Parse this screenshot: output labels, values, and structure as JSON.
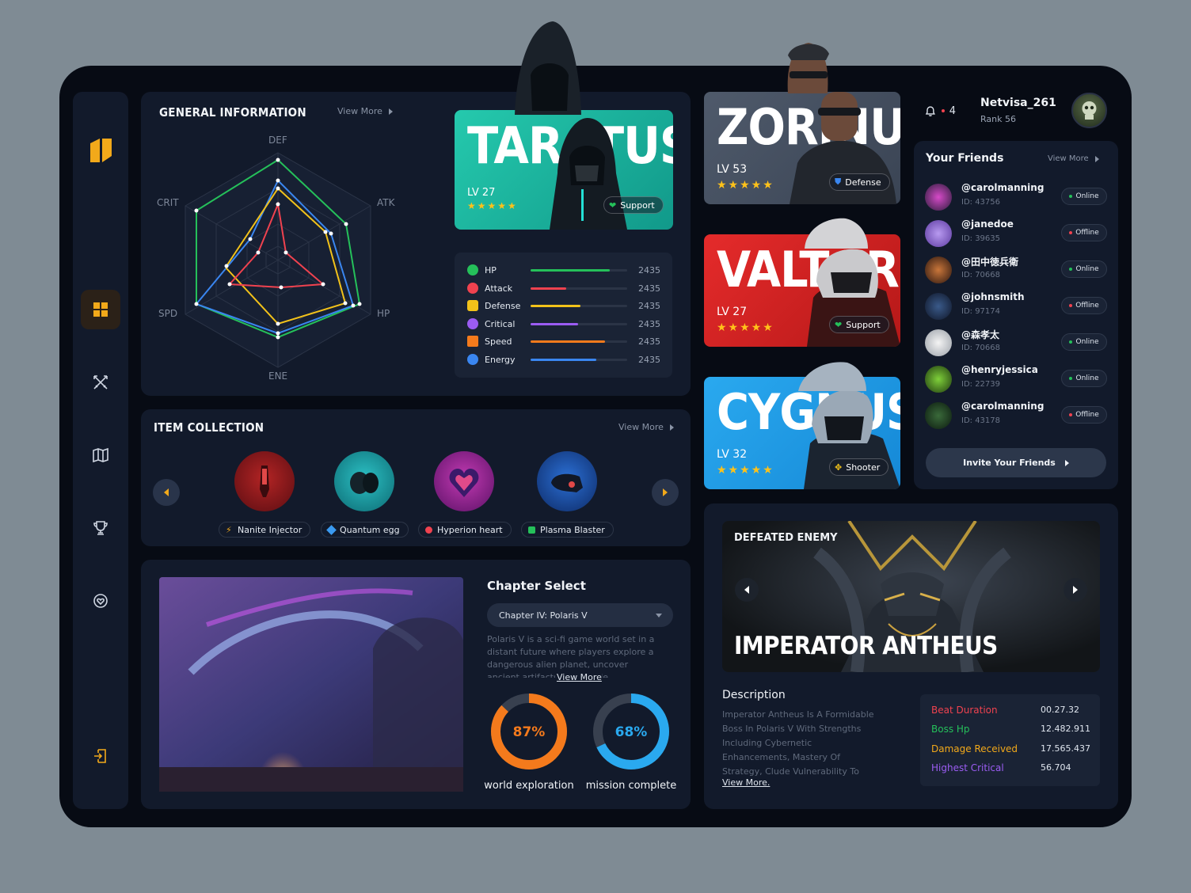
{
  "general": {
    "title": "GENERAL INFORMATION",
    "view_more": "View More",
    "radar_labels": [
      "DEF",
      "ATK",
      "HP",
      "ENE",
      "SPD",
      "CRIT"
    ]
  },
  "stats": [
    {
      "label": "HP",
      "value": "2435",
      "fill": 0.82,
      "color": "#25c05a"
    },
    {
      "label": "Attack",
      "value": "2435",
      "fill": 0.37,
      "color": "#f0424f"
    },
    {
      "label": "Defense",
      "value": "2435",
      "fill": 0.52,
      "color": "#f2c21a"
    },
    {
      "label": "Critical",
      "value": "2435",
      "fill": 0.49,
      "color": "#9b5cf2"
    },
    {
      "label": "Speed",
      "value": "2435",
      "fill": 0.77,
      "color": "#f47a1c"
    },
    {
      "label": "Energy",
      "value": "2435",
      "fill": 0.68,
      "color": "#3a86f0"
    }
  ],
  "heroes": [
    {
      "name": "TARATUS",
      "level": "LV 27",
      "role": "Support",
      "stars": "★★★★★"
    },
    {
      "name": "ZORINUS",
      "level": "LV 53",
      "role": "Defense",
      "stars": "★★★★★"
    },
    {
      "name": "VALTORIN",
      "level": "LV 27",
      "role": "Support",
      "stars": "★★★★★"
    },
    {
      "name": "CYGNUST",
      "level": "LV 32",
      "role": "Shooter",
      "stars": "★★★★★"
    }
  ],
  "items": {
    "title": "ITEM COLLECTION",
    "view_more": "View More",
    "list": [
      {
        "name": "Nanite Injector"
      },
      {
        "name": "Quantum egg"
      },
      {
        "name": "Hyperion heart"
      },
      {
        "name": "Plasma Blaster"
      }
    ]
  },
  "chapter": {
    "title": "Chapter Select",
    "selected": "Chapter IV: Polaris V",
    "description": "Polaris V is a sci-fi game world set in a distant future where players explore a dangerous alien planet, uncover ancient artifacts, and battle",
    "view_more": "View More",
    "progress": [
      {
        "label": "world exploration",
        "percent": 87,
        "text": "87%"
      },
      {
        "label": "mission complete",
        "percent": 68,
        "text": "68%"
      }
    ]
  },
  "user": {
    "name": "Netvisa_261",
    "rank": "Rank 56",
    "notifications": "4"
  },
  "friends": {
    "title": "Your Friends",
    "view_more": "View More",
    "invite": "Invite Your Friends",
    "list": [
      {
        "handle": "@carolmanning",
        "id": "ID: 43756",
        "status": "Online"
      },
      {
        "handle": "@janedoe",
        "id": "ID: 39635",
        "status": "Offline"
      },
      {
        "handle": "@田中徳兵衛",
        "id": "ID: 70668",
        "status": "Online"
      },
      {
        "handle": "@johnsmith",
        "id": "ID: 97174",
        "status": "Offline"
      },
      {
        "handle": "@森孝太",
        "id": "ID: 70668",
        "status": "Online"
      },
      {
        "handle": "@henryjessica",
        "id": "ID: 22739",
        "status": "Online"
      },
      {
        "handle": "@carolmanning",
        "id": "ID: 43178",
        "status": "Offline"
      }
    ]
  },
  "enemy": {
    "tag": "DEFEATED ENEMY",
    "name": "IMPERATOR ANTHEUS",
    "desc_title": "Description",
    "description": "Imperator Antheus Is A Formidable Boss In Polaris V With Strengths Including Cybernetic Enhancements, Mastery Of Strategy, Clude Vulnerability To Unconventio",
    "view_more": "View More.",
    "stats": [
      {
        "label": "Beat Duration",
        "value": "00.27.32",
        "color": "#f0424f"
      },
      {
        "label": "Boss Hp",
        "value": "12.482.911",
        "color": "#25c05a"
      },
      {
        "label": "Damage Received",
        "value": "17.565.437",
        "color": "#f2a91a"
      },
      {
        "label": "Highest Critical",
        "value": "56.704",
        "color": "#9b5cf2"
      }
    ]
  },
  "colors": {
    "accent": "#f2a91a",
    "panel": "#121a2b",
    "background": "#070b14"
  }
}
